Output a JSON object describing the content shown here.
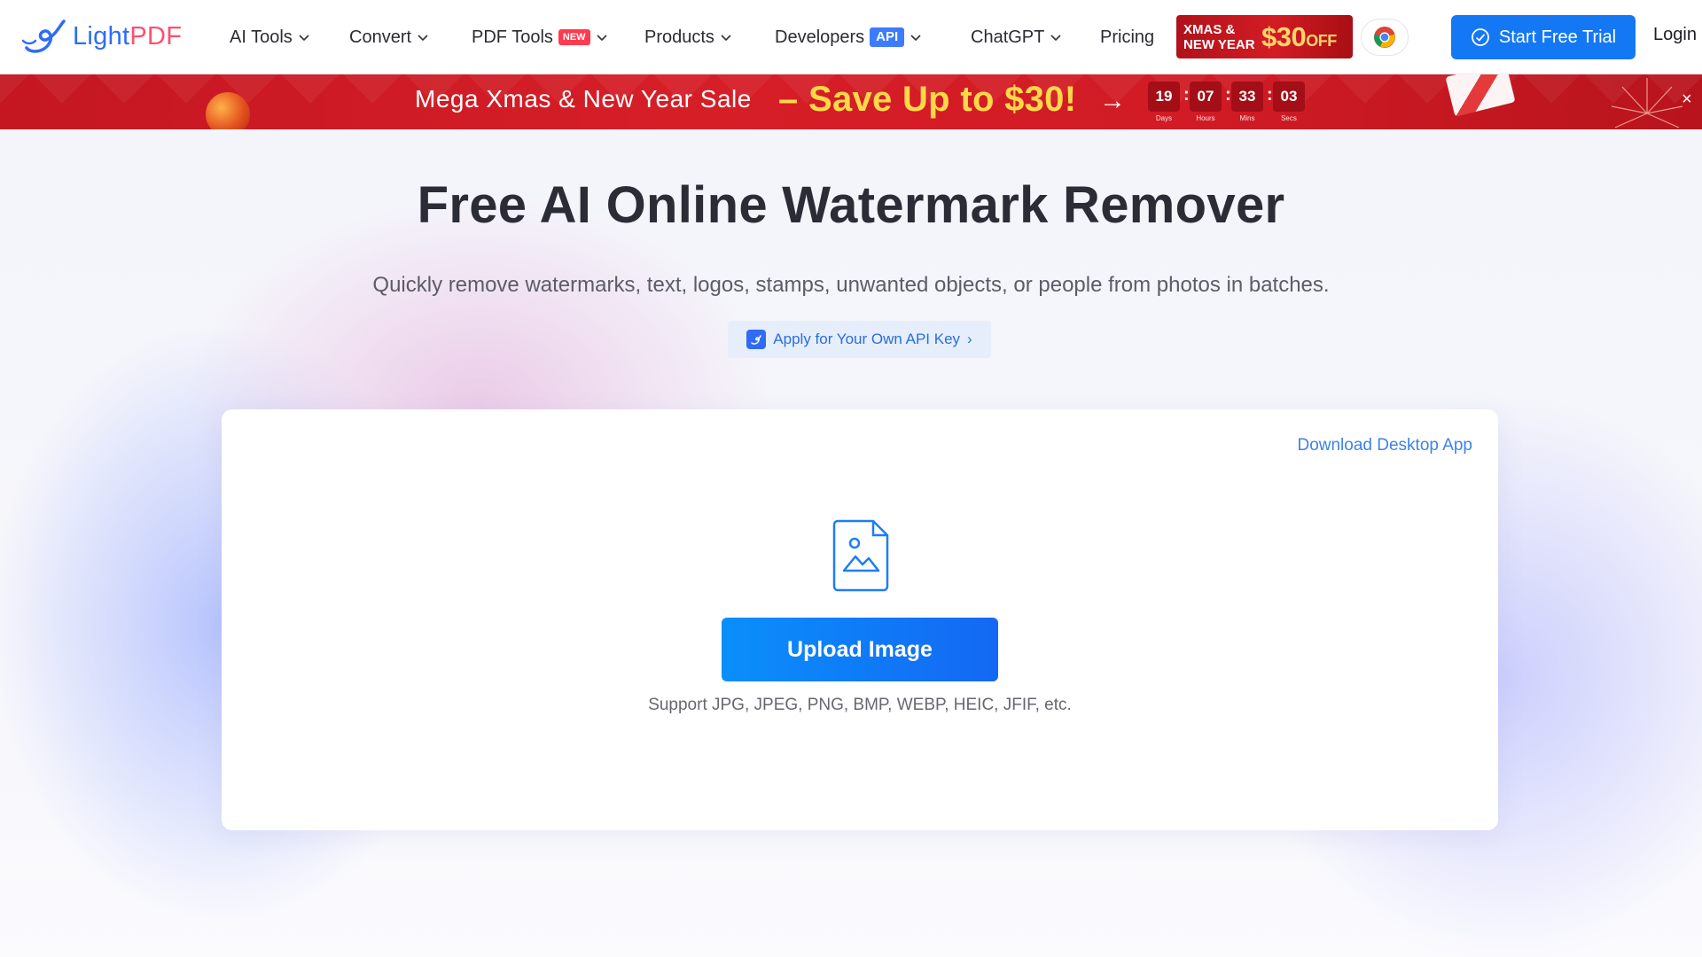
{
  "brand": {
    "logo_text_light": "Light",
    "logo_text_pdf": "PDF",
    "logo_icon": "lightpdf-swirl-icon",
    "accent_color": "#1478f5",
    "sale_red": "#d11b25"
  },
  "nav": {
    "items": [
      {
        "label": "AI Tools",
        "has_dropdown": true
      },
      {
        "label": "Convert",
        "has_dropdown": true
      },
      {
        "label": "PDF Tools",
        "badge": "NEW",
        "has_dropdown": true
      },
      {
        "label": "Products",
        "has_dropdown": true
      },
      {
        "label": "Developers",
        "badge": "API",
        "has_dropdown": true
      },
      {
        "label": "ChatGPT",
        "has_dropdown": true
      },
      {
        "label": "Pricing",
        "has_dropdown": false
      }
    ],
    "promo_badge": {
      "line1": "XMAS &",
      "line2": "NEW YEAR",
      "amount": "$30",
      "suffix": "OFF"
    },
    "chrome_icon": "chrome-icon",
    "start_trial_label": "Start Free Trial",
    "login_label": "Login"
  },
  "sale_banner": {
    "text": "Mega Xmas & New Year Sale",
    "highlight": "– Save Up to $30!",
    "arrow": "→",
    "countdown": [
      {
        "value": "19",
        "unit": "Days"
      },
      {
        "value": "07",
        "unit": "Hours"
      },
      {
        "value": "33",
        "unit": "Mins"
      },
      {
        "value": "03",
        "unit": "Secs"
      }
    ],
    "close": "×"
  },
  "hero": {
    "title": "Free AI Online Watermark Remover",
    "subtitle": "Quickly remove watermarks, text, logos, stamps, unwanted objects, or people from photos in batches.",
    "api_link": "Apply for Your Own API Key",
    "api_link_chevron": "›"
  },
  "upload": {
    "desktop_link": "Download Desktop App",
    "icon": "image-file-icon",
    "button_label": "Upload Image",
    "support_text": "Support JPG, JPEG, PNG, BMP, WEBP, HEIC, JFIF, etc."
  }
}
